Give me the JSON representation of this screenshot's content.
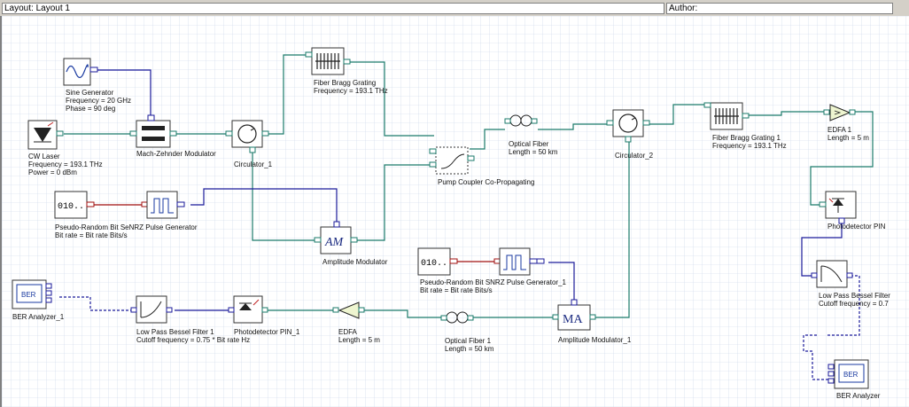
{
  "header": {
    "layout_label": "Layout: Layout 1",
    "author_label": "Author:"
  },
  "components": {
    "sine_generator": {
      "name": "Sine Generator",
      "p1": "Frequency = 20  GHz",
      "p2": "Phase = 90  deg"
    },
    "cw_laser": {
      "name": "CW Laser",
      "p1": "Frequency = 193.1  THz",
      "p2": "Power = 0  dBm"
    },
    "mz_modulator": {
      "name": "Mach-Zehnder Modulator"
    },
    "circulator_1": {
      "name": "Circulator_1"
    },
    "fbg": {
      "name": "Fiber Bragg Grating",
      "p1": "Frequency = 193.1  THz"
    },
    "pump_coupler": {
      "name": "Pump Coupler Co-Propagating"
    },
    "optical_fiber": {
      "name": "Optical Fiber",
      "p1": "Length = 50  km"
    },
    "circulator_2": {
      "name": "Circulator_2"
    },
    "fbg_1": {
      "name": "Fiber Bragg Grating  1",
      "p1": "Frequency = 193.1  THz"
    },
    "edfa_1": {
      "name": "EDFA  1",
      "p1": "Length = 5  m"
    },
    "prbs": {
      "name": "Pseudo-Random Bit Se",
      "suffix": "NRZ Pulse Generator",
      "p1": "Bit rate = Bit rate  Bits/s",
      "icon_text": "010.."
    },
    "am_modulator": {
      "name": "Amplitude Modulator",
      "icon_text": "AM"
    },
    "photodetector_pin": {
      "name": "Photodetector PIN"
    },
    "prbs_1": {
      "name": "Pseudo-Random Bit S",
      "suffix": "NRZ Pulse Generator_1",
      "p1": "Bit rate = Bit rate  Bits/s",
      "icon_text": "010.."
    },
    "lpbf": {
      "name": "Low Pass Bessel Filter",
      "p1": "Cutoff frequency = 0.7"
    },
    "ber_analyzer_1": {
      "name": "BER Analyzer_1",
      "icon_text": "BER"
    },
    "lpbf_1": {
      "name": "Low Pass Bessel Filter  1",
      "p1": "Cutoff frequency = 0.75 * Bit rate  Hz"
    },
    "photodetector_pin_1": {
      "name": "Photodetector PIN_1"
    },
    "edfa": {
      "name": "EDFA",
      "p1": "Length = 5  m"
    },
    "optical_fiber_1": {
      "name": "Optical Fiber  1",
      "p1": "Length = 50  km"
    },
    "am_modulator_1": {
      "name": "Amplitude Modulator_1",
      "icon_text": "MA"
    },
    "ber_analyzer": {
      "name": "BER Analyzer",
      "icon_text": "BER"
    }
  },
  "colors": {
    "optical_wire": "#1a7a6a",
    "electrical_wire": "#1a1a9a",
    "grid": "#c8d4e8",
    "canvas_bg": "#ffffff"
  }
}
